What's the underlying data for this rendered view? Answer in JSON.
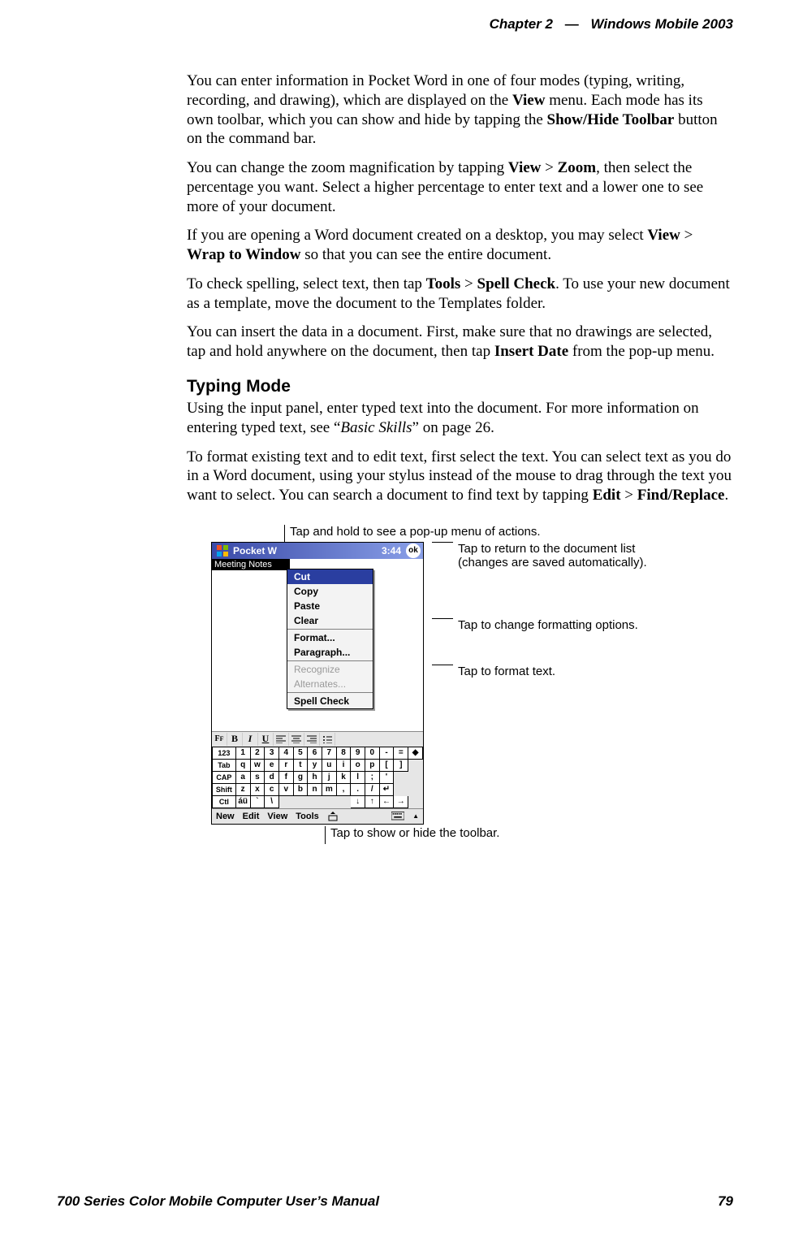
{
  "header": {
    "chapter": "Chapter  2",
    "dash": "—",
    "product": "Windows Mobile 2003"
  },
  "body": {
    "p1a": "You can enter information in Pocket Word in one of four modes (typing, writing, recording, and drawing), which are displayed on the ",
    "p1b": "View",
    "p1c": " menu. Each mode has its own toolbar, which you can show and hide by tapping the ",
    "p1d": "Show/Hide Toolbar",
    "p1e": " button on the command bar.",
    "p2a": "You can change the zoom magnification by tapping ",
    "p2b": "View",
    "p2gt1": " > ",
    "p2c": "Zoom",
    "p2d": ", then select the percentage you want. Select a higher percentage to enter text and a lower one to see more of your document.",
    "p3a": "If you are opening a Word document created on a desktop, you may select ",
    "p3b": "View",
    "p3gt": " > ",
    "p3c": "Wrap to Window",
    "p3d": " so that you can see the entire document.",
    "p4a": "To check spelling, select text, then tap ",
    "p4b": "Tools",
    "p4gt": " > ",
    "p4c": "Spell Check",
    "p4d": ". To use your new document as a template, move the document to the Templates folder.",
    "p5a": "You can insert the data in a document. First, make sure that no drawings are selected, tap and hold anywhere on the document, then tap ",
    "p5b": "Insert Date",
    "p5c": " from the pop-up menu.",
    "h_typing": "Typing Mode",
    "p6a": "Using the input panel, enter typed text into the document. For more information on entering typed text, see “",
    "p6b": "Basic Skills",
    "p6c": "” on page 26.",
    "p7a": "To format existing text and to edit text, first select the text. You can select text as you do in a Word document, using your stylus instead of the mouse to drag through the text you want to select. You can search a document to find text by tapping ",
    "p7b": "Edit",
    "p7gt": " > ",
    "p7c": "Find/Replace",
    "p7d": "."
  },
  "callouts": {
    "top": "Tap and hold to see a pop-up menu of actions.",
    "r1": "Tap to return to the document list (changes are saved automatically).",
    "r2": "Tap to change formatting options.",
    "r3": "Tap to format text.",
    "bottom": "Tap to show or hide the toolbar."
  },
  "device": {
    "app": "Pocket W",
    "time": "3:44",
    "ok": "ok",
    "doc_title": "Meeting Notes",
    "menu": {
      "cut": "Cut",
      "copy": "Copy",
      "paste": "Paste",
      "clear": "Clear",
      "format": "Format...",
      "paragraph": "Paragraph...",
      "recognize": "Recognize",
      "alternates": "Alternates...",
      "spell": "Spell Check"
    },
    "fmt": {
      "ff": "F",
      "b": "B",
      "i": "I",
      "u": "U"
    },
    "kbd_rows": [
      {
        "lbl": "123",
        "keys": [
          "1",
          "2",
          "3",
          "4",
          "5",
          "6",
          "7",
          "8",
          "9",
          "0",
          "-",
          "=",
          "◆"
        ]
      },
      {
        "lbl": "Tab",
        "keys": [
          "q",
          "w",
          "e",
          "r",
          "t",
          "y",
          "u",
          "i",
          "o",
          "p",
          "[",
          "]",
          ""
        ]
      },
      {
        "lbl": "CAP",
        "keys": [
          "a",
          "s",
          "d",
          "f",
          "g",
          "h",
          "j",
          "k",
          "l",
          ";",
          "'",
          "",
          ""
        ]
      },
      {
        "lbl": "Shift",
        "keys": [
          "z",
          "x",
          "c",
          "v",
          "b",
          "n",
          "m",
          ",",
          ".",
          "/",
          "↵",
          "",
          ""
        ]
      },
      {
        "lbl": "Ctl",
        "keys": [
          "áü",
          "`",
          "\\",
          "",
          "",
          "",
          "",
          "",
          "↓",
          "↑",
          "←",
          "→",
          ""
        ]
      }
    ],
    "menubar": {
      "new": "New",
      "edit": "Edit",
      "view": "View",
      "tools": "Tools"
    }
  },
  "footer": {
    "left": "700 Series Color Mobile Computer User’s Manual",
    "right": "79"
  }
}
